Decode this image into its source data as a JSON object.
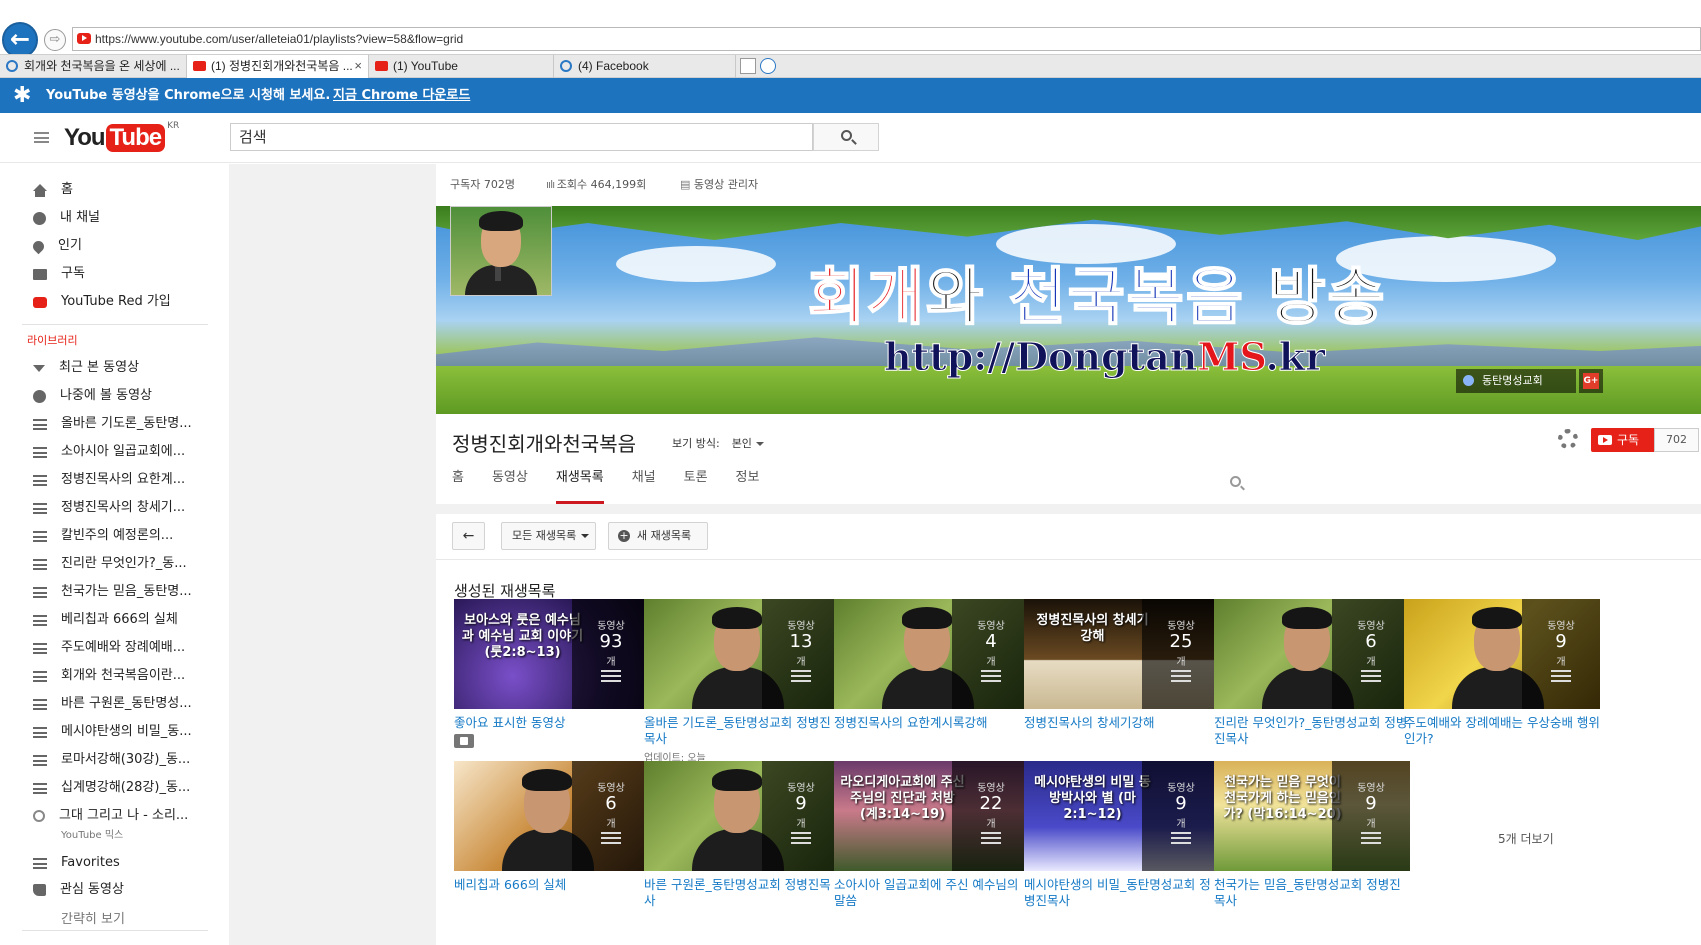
{
  "browser": {
    "url": "https://www.youtube.com/user/alleteia01/playlists?view=58&flow=grid",
    "tabs": [
      {
        "label": "회개와 천국복음을 온 세상에 ...",
        "icon": "ie-icon",
        "active": false
      },
      {
        "label": "(1) 정병진회개와천국복음 ...",
        "icon": "youtube-icon",
        "active": true,
        "close": "×"
      },
      {
        "label": "(1) YouTube",
        "icon": "youtube-icon",
        "active": false
      },
      {
        "label": "(4) Facebook",
        "icon": "ie-icon",
        "active": false
      }
    ]
  },
  "promo": {
    "message": "YouTube 동영상을 Chrome으로 시청해 보세요.",
    "link": "지금 Chrome 다운로드"
  },
  "masthead": {
    "logo_you": "You",
    "logo_tube": "Tube",
    "region": "KR",
    "search_placeholder": "검색"
  },
  "sidebar": {
    "main": [
      {
        "label": "홈",
        "icon": "home-icon"
      },
      {
        "label": "내 채널",
        "icon": "account-icon"
      },
      {
        "label": "인기",
        "icon": "trending-icon"
      },
      {
        "label": "구독",
        "icon": "subscriptions-icon"
      },
      {
        "label": "YouTube Red 가입",
        "icon": "youtube-red-icon"
      }
    ],
    "library_heading": "라이브러리",
    "library": [
      {
        "label": "최근 본 동영상",
        "icon": "history-icon"
      },
      {
        "label": "나중에 볼 동영상",
        "icon": "watch-later-icon"
      },
      {
        "label": "올바른 기도론_동탄명...",
        "icon": "playlist-icon"
      },
      {
        "label": "소아시아 일곱교회에...",
        "icon": "playlist-icon"
      },
      {
        "label": "정병진목사의 요한계...",
        "icon": "playlist-icon"
      },
      {
        "label": "정병진목사의 창세기...",
        "icon": "playlist-icon"
      },
      {
        "label": "칼빈주의 예정론의...",
        "icon": "playlist-icon"
      },
      {
        "label": "진리란 무엇인가?_동...",
        "icon": "playlist-icon"
      },
      {
        "label": "천국가는 믿음_동탄명...",
        "icon": "playlist-icon"
      },
      {
        "label": "베리칩과 666의 실체",
        "icon": "playlist-icon"
      },
      {
        "label": "주도예배와 장례예배...",
        "icon": "playlist-icon"
      },
      {
        "label": "회개와 천국복음이란...",
        "icon": "playlist-icon"
      },
      {
        "label": "바른 구원론_동탄명성...",
        "icon": "playlist-icon"
      },
      {
        "label": "메시야탄생의 비밀_동...",
        "icon": "playlist-icon"
      },
      {
        "label": "로마서강해(30강)_동...",
        "icon": "playlist-icon"
      },
      {
        "label": "십계명강해(28강)_동...",
        "icon": "playlist-icon"
      },
      {
        "label": "그대 그리고 나 - 소리...",
        "icon": "mix-icon",
        "sub": "YouTube 믹스"
      },
      {
        "label": "Favorites",
        "icon": "playlist-icon"
      },
      {
        "label": "관심 동영상",
        "icon": "liked-icon"
      }
    ],
    "show_less": "간략히 보기"
  },
  "channel": {
    "subscribers": "구독자 702명",
    "views": "조회수 464,199회",
    "video_manager": "동영상 관리자",
    "banner_title_parts": [
      {
        "text": "회개",
        "cls": "r"
      },
      {
        "text": "와 ",
        "cls": "k"
      },
      {
        "text": "천국복음",
        "cls": "b"
      },
      {
        "text": " 방송",
        "cls": "k"
      }
    ],
    "banner_url_parts": [
      {
        "text": "http://Dongtan",
        "cls": ""
      },
      {
        "text": "MS",
        "cls": "red"
      },
      {
        "text": ".kr",
        "cls": ""
      }
    ],
    "banner_link": "동탄명성교회",
    "gplus": "G+",
    "name": "정병진회개와천국복음",
    "view_as_label": "보기 방식:",
    "view_as_value": "본인",
    "subscribe_label": "구독",
    "subscribe_count": "702",
    "tabs": [
      "홈",
      "동영상",
      "재생목록",
      "채널",
      "토론",
      "정보"
    ],
    "active_tab": 2
  },
  "toolbar": {
    "back": "←",
    "all_playlists": "모든 재생목록",
    "new_playlist": "새 재생목록",
    "plus": "+"
  },
  "playlists": {
    "heading": "생성된 재생목록",
    "count_label": "동영상",
    "unit": "개",
    "more": "5개 더보기",
    "items": [
      {
        "title": "좋아요 표시한 동영상",
        "count": "93",
        "thumb_text": "보아스와 룻은 예수님과 예수님 교회 이야기 (룻2:8~13)",
        "style": "purple",
        "lock": true
      },
      {
        "title": "올바른 기도론_동탄명성교회 정병진목사",
        "count": "13",
        "style": "green",
        "meta": "업데이트: 오늘"
      },
      {
        "title": "정병진목사의 요한계시록강해",
        "count": "4",
        "style": "green"
      },
      {
        "title": "정병진목사의 창세기강해",
        "count": "25",
        "style": "bible",
        "thumb_text": "정병진목사의 창세기 강해"
      },
      {
        "title": "진리란 무엇인가?_동탄명성교회 정병진목사",
        "count": "6",
        "style": "green"
      },
      {
        "title": "주도예배와 장례예배는 우상숭배 행위인가?",
        "count": "9",
        "style": "yellow"
      },
      {
        "title": "베리칩과 666의 실체",
        "count": "6",
        "style": "stage"
      },
      {
        "title": "바른 구원론_동탄명성교회 정병진목사",
        "count": "9",
        "style": "green"
      },
      {
        "title": "소아시아 일곱교회에 주신 예수님의 말씀",
        "count": "22",
        "style": "city",
        "thumb_text": "라오디게아교회에 주신 주님의 진단과 처방 (계3:14~19)"
      },
      {
        "title": "메시야탄생의 비밀_동탄명성교회 정병진목사",
        "count": "9",
        "style": "night",
        "thumb_text": "메시야탄생의 비밀 동방박사와 별 (마2:1~12)"
      },
      {
        "title": "천국가는 믿음_동탄명성교회 정병진목사",
        "count": "9",
        "style": "sheep",
        "thumb_text": "천국가는 믿음 무엇이 천국가게 하는 믿음인가? (막16:14~20)"
      }
    ]
  },
  "colors": {
    "youtube_red": "#e62117",
    "promo_blue": "#1e73be",
    "link_blue": "#167ac6"
  }
}
